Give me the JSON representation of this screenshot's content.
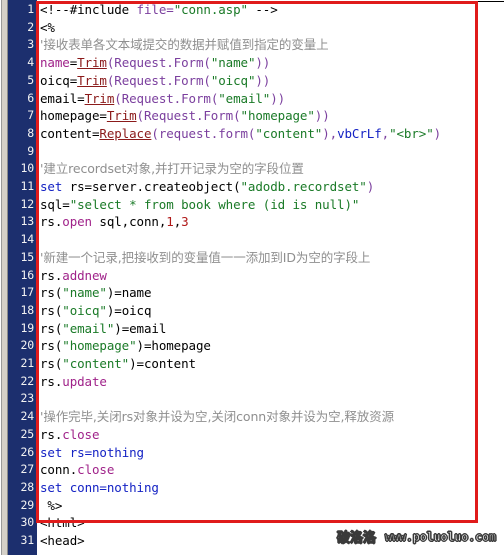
{
  "editor": {
    "language": "asp-vbscript",
    "total_lines": 31,
    "gutter_background": "#1c2f6e",
    "gutter_text_color": "#f2f2f2",
    "code_background": "#ffffff",
    "annotation_box_color": "#e01b1b",
    "line_numbers": [
      "1",
      "2",
      "3",
      "4",
      "5",
      "6",
      "7",
      "8",
      "9",
      "10",
      "11",
      "12",
      "13",
      "14",
      "15",
      "16",
      "17",
      "18",
      "19",
      "20",
      "21",
      "22",
      "23",
      "24",
      "25",
      "26",
      "27",
      "28",
      "29",
      "30",
      "31"
    ]
  },
  "colors": {
    "string": "#1a7a27",
    "keyword": "#1422c4",
    "method": "#a0238a",
    "function": "#8b1a1a",
    "number": "#b01818",
    "comment": "#8f8f8f",
    "punctuation": "#7b3f9e",
    "plain": "#000000"
  },
  "code": {
    "lines": [
      {
        "n": "1",
        "text": "<!--#include file=\"conn.asp\" -->",
        "tokens": [
          {
            "t": "<!--#include ",
            "c": "plain"
          },
          {
            "t": "file=",
            "c": "attr"
          },
          {
            "t": "\"conn.asp\"",
            "c": "str"
          },
          {
            "t": " -->",
            "c": "plain"
          }
        ]
      },
      {
        "n": "2",
        "text": "<%",
        "tokens": [
          {
            "t": "<%",
            "c": "plain"
          }
        ]
      },
      {
        "n": "3",
        "text": "'接收表单各文本域提交的数据并赋值到指定的变量上",
        "tokens": [
          {
            "t": "'接收表单各文本域提交的数据并赋值到指定的变量上",
            "c": "cmt"
          }
        ]
      },
      {
        "n": "4",
        "text": "name=Trim(Request.Form(\"name\"))",
        "tokens": [
          {
            "t": "name",
            "c": "var"
          },
          {
            "t": "=",
            "c": "plain"
          },
          {
            "t": "Trim",
            "c": "func"
          },
          {
            "t": "(Request.Form(",
            "c": "punc"
          },
          {
            "t": "\"name\"",
            "c": "str"
          },
          {
            "t": "))",
            "c": "punc"
          }
        ]
      },
      {
        "n": "5",
        "text": "oicq=Trim(Request.Form(\"oicq\"))",
        "tokens": [
          {
            "t": "oicq",
            "c": "plain"
          },
          {
            "t": "=",
            "c": "plain"
          },
          {
            "t": "Trim",
            "c": "func"
          },
          {
            "t": "(Request.Form(",
            "c": "punc"
          },
          {
            "t": "\"oicq\"",
            "c": "str"
          },
          {
            "t": "))",
            "c": "punc"
          }
        ]
      },
      {
        "n": "6",
        "text": "email=Trim(Request.Form(\"email\"))",
        "tokens": [
          {
            "t": "email",
            "c": "plain"
          },
          {
            "t": "=",
            "c": "plain"
          },
          {
            "t": "Trim",
            "c": "func"
          },
          {
            "t": "(Request.Form(",
            "c": "punc"
          },
          {
            "t": "\"email\"",
            "c": "str"
          },
          {
            "t": "))",
            "c": "punc"
          }
        ]
      },
      {
        "n": "7",
        "text": "homepage=Trim(Request.Form(\"homepage\"))",
        "tokens": [
          {
            "t": "homepage",
            "c": "plain"
          },
          {
            "t": "=",
            "c": "plain"
          },
          {
            "t": "Trim",
            "c": "func"
          },
          {
            "t": "(Request.Form(",
            "c": "punc"
          },
          {
            "t": "\"homepage\"",
            "c": "str"
          },
          {
            "t": "))",
            "c": "punc"
          }
        ]
      },
      {
        "n": "8",
        "text": "content=Replace(request.form(\"content\"),vbCrLf,\"<br>\")",
        "tokens": [
          {
            "t": "content=",
            "c": "plain"
          },
          {
            "t": "Replace",
            "c": "func"
          },
          {
            "t": "(request.form(",
            "c": "punc"
          },
          {
            "t": "\"content\"",
            "c": "str"
          },
          {
            "t": "),",
            "c": "punc"
          },
          {
            "t": "vbCrLf",
            "c": "const"
          },
          {
            "t": ",",
            "c": "punc"
          },
          {
            "t": "\"<br>\"",
            "c": "str"
          },
          {
            "t": ")",
            "c": "punc"
          }
        ]
      },
      {
        "n": "9",
        "text": "",
        "tokens": []
      },
      {
        "n": "10",
        "text": "'建立recordset对象,并打开记录为空的字段位置",
        "tokens": [
          {
            "t": "'建立recordset对象,并打开记录为空的字段位置",
            "c": "cmt"
          }
        ]
      },
      {
        "n": "11",
        "text": "set rs=server.createobject(\"adodb.recordset\")",
        "tokens": [
          {
            "t": "set",
            "c": "kw"
          },
          {
            "t": " rs=server.createobject(",
            "c": "plain"
          },
          {
            "t": "\"adodb.recordset\"",
            "c": "str"
          },
          {
            "t": ")",
            "c": "punc"
          }
        ]
      },
      {
        "n": "12",
        "text": "sql=\"select * from book where (id is null)\"",
        "tokens": [
          {
            "t": "sql=",
            "c": "plain"
          },
          {
            "t": "\"select * from book where (id is null)\"",
            "c": "str"
          }
        ]
      },
      {
        "n": "13",
        "text": "rs.open sql,conn,1,3",
        "tokens": [
          {
            "t": "rs.",
            "c": "plain"
          },
          {
            "t": "open",
            "c": "meth"
          },
          {
            "t": " sql,conn,",
            "c": "plain"
          },
          {
            "t": "1",
            "c": "num"
          },
          {
            "t": ",",
            "c": "plain"
          },
          {
            "t": "3",
            "c": "num"
          }
        ]
      },
      {
        "n": "14",
        "text": "",
        "tokens": []
      },
      {
        "n": "15",
        "text": "'新建一个记录,把接收到的变量值一一添加到ID为空的字段上",
        "tokens": [
          {
            "t": "'新建一个记录,把接收到的变量值一一添加到ID为空的字段上",
            "c": "cmt"
          }
        ]
      },
      {
        "n": "16",
        "text": "rs.addnew",
        "tokens": [
          {
            "t": "rs.",
            "c": "plain"
          },
          {
            "t": "addnew",
            "c": "meth"
          }
        ]
      },
      {
        "n": "17",
        "text": "rs(\"name\")=name",
        "tokens": [
          {
            "t": "rs(",
            "c": "plain"
          },
          {
            "t": "\"name\"",
            "c": "str"
          },
          {
            "t": ")=name",
            "c": "plain"
          }
        ]
      },
      {
        "n": "18",
        "text": "rs(\"oicq\")=oicq",
        "tokens": [
          {
            "t": "rs(",
            "c": "plain"
          },
          {
            "t": "\"oicq\"",
            "c": "str"
          },
          {
            "t": ")=oicq",
            "c": "plain"
          }
        ]
      },
      {
        "n": "19",
        "text": "rs(\"email\")=email",
        "tokens": [
          {
            "t": "rs(",
            "c": "plain"
          },
          {
            "t": "\"email\"",
            "c": "str"
          },
          {
            "t": ")=email",
            "c": "plain"
          }
        ]
      },
      {
        "n": "20",
        "text": "rs(\"homepage\")=homepage",
        "tokens": [
          {
            "t": "rs(",
            "c": "plain"
          },
          {
            "t": "\"homepage\"",
            "c": "str"
          },
          {
            "t": ")=homepage",
            "c": "plain"
          }
        ]
      },
      {
        "n": "21",
        "text": "rs(\"content\")=content",
        "tokens": [
          {
            "t": "rs(",
            "c": "plain"
          },
          {
            "t": "\"content\"",
            "c": "str"
          },
          {
            "t": ")=content",
            "c": "plain"
          }
        ]
      },
      {
        "n": "22",
        "text": "rs.update",
        "tokens": [
          {
            "t": "rs.",
            "c": "plain"
          },
          {
            "t": "update",
            "c": "meth"
          }
        ]
      },
      {
        "n": "23",
        "text": "",
        "tokens": []
      },
      {
        "n": "24",
        "text": "'操作完毕,关闭rs对象并设为空,关闭conn对象并设为空,释放资源",
        "tokens": [
          {
            "t": "'操作完毕,关闭rs对象并设为空,关闭conn对象并设为空,释放资源",
            "c": "cmt"
          }
        ]
      },
      {
        "n": "25",
        "text": "rs.close",
        "tokens": [
          {
            "t": "rs.",
            "c": "plain"
          },
          {
            "t": "close",
            "c": "meth"
          }
        ]
      },
      {
        "n": "26",
        "text": "set rs=nothing",
        "tokens": [
          {
            "t": "set",
            "c": "kw"
          },
          {
            "t": " ",
            "c": "plain"
          },
          {
            "t": "rs=nothing",
            "c": "kw"
          }
        ]
      },
      {
        "n": "27",
        "text": "conn.close",
        "tokens": [
          {
            "t": "conn.",
            "c": "plain"
          },
          {
            "t": "close",
            "c": "meth"
          }
        ]
      },
      {
        "n": "28",
        "text": "set conn=nothing",
        "tokens": [
          {
            "t": "set",
            "c": "kw"
          },
          {
            "t": " ",
            "c": "plain"
          },
          {
            "t": "conn=nothing",
            "c": "kw"
          }
        ]
      },
      {
        "n": "29",
        "text": " %>",
        "tokens": [
          {
            "t": " %>",
            "c": "plain"
          }
        ]
      },
      {
        "n": "30",
        "text": "<html>",
        "tokens": [
          {
            "t": "<html>",
            "c": "plain"
          }
        ]
      },
      {
        "n": "31",
        "text": "<head>",
        "tokens": [
          {
            "t": "<head>",
            "c": "plain"
          }
        ]
      }
    ]
  },
  "watermark": {
    "site_name_cn": "破洛洛",
    "site_url": "www.poluoluo.com"
  }
}
